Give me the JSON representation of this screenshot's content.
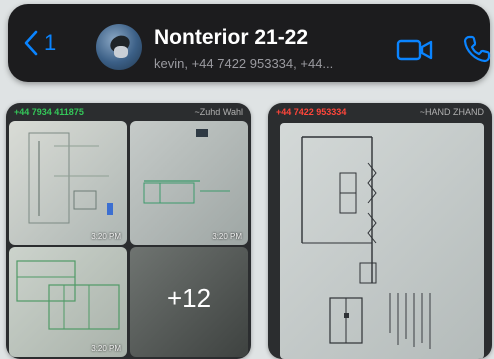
{
  "header": {
    "back_count": "1",
    "title": "Nonterior 21-22",
    "subtitle": "kevin, +44 7422 953334, +44..."
  },
  "media_left": {
    "sender_phone": "+44 7934 411875",
    "sender_name": "~Zuhd Wahl",
    "timestamps": [
      "3:20 PM",
      "3:20 PM",
      "3:20 PM"
    ],
    "more_count": "+12"
  },
  "media_right": {
    "sender_phone": "+44 7422 953334",
    "sender_name": "~HAND ZHAND"
  },
  "colors": {
    "accent": "#0a84ff",
    "header_bg": "#1c1c1e",
    "green": "#34c759",
    "red": "#ff453a"
  },
  "icons": [
    "chevron-left-icon",
    "video-call-icon",
    "phone-call-icon"
  ]
}
